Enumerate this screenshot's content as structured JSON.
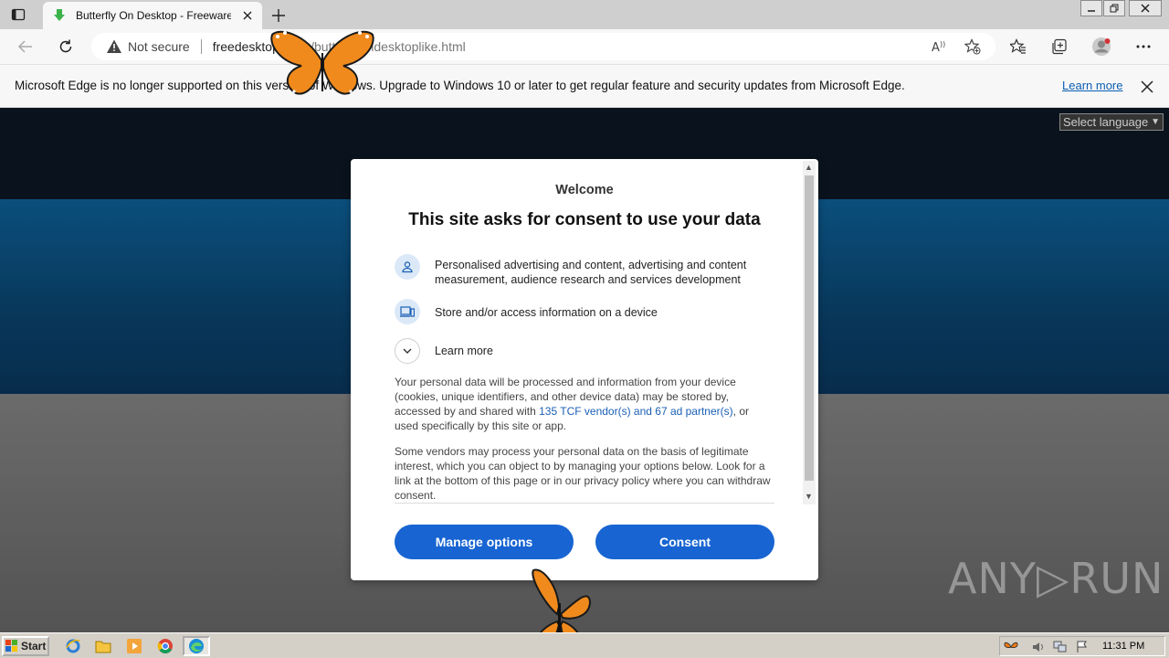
{
  "browser": {
    "tab": {
      "title": "Butterfly On Desktop - Freeware a",
      "favicon": "download-arrow-icon"
    },
    "address": {
      "security_label": "Not secure",
      "url_domain": "freedesktop",
      "url_hidden_mid": " ",
      "url_rest": ".com/butterflyondesktoplike.html"
    },
    "infobar": {
      "message": "Microsoft Edge is no longer supported on this version of Windows. Upgrade to Windows 10 or later to get regular feature and security updates from Microsoft Edge.",
      "learn_more": "Learn more"
    }
  },
  "page": {
    "language_select": "Select language",
    "watermark": "ANY▷RUN"
  },
  "consent": {
    "welcome": "Welcome",
    "title": "This site asks for consent to use your data",
    "purposes": [
      {
        "icon": "person-icon",
        "text": "Personalised advertising and content, advertising and content measurement, audience research and services development"
      },
      {
        "icon": "devices-icon",
        "text": "Store and/or access information on a device"
      },
      {
        "icon": "chevron-down-icon",
        "text": "Learn more"
      }
    ],
    "para1_before": "Your personal data will be processed and information from your device (cookies, unique identifiers, and other device data) may be stored by, accessed by and shared with ",
    "para1_link": "135 TCF vendor(s) and 67 ad partner(s)",
    "para1_after": ", or used specifically by this site or app.",
    "para2": "Some vendors may process your personal data on the basis of legitimate interest, which you can object to by managing your options below. Look for a link at the bottom of this page or in our privacy policy where you can withdraw consent.",
    "manage_button": "Manage options",
    "consent_button": "Consent"
  },
  "taskbar": {
    "start_label": "Start",
    "clock": "11:31 PM"
  },
  "colors": {
    "accent": "#1764d2",
    "link": "#1a5fb4"
  }
}
